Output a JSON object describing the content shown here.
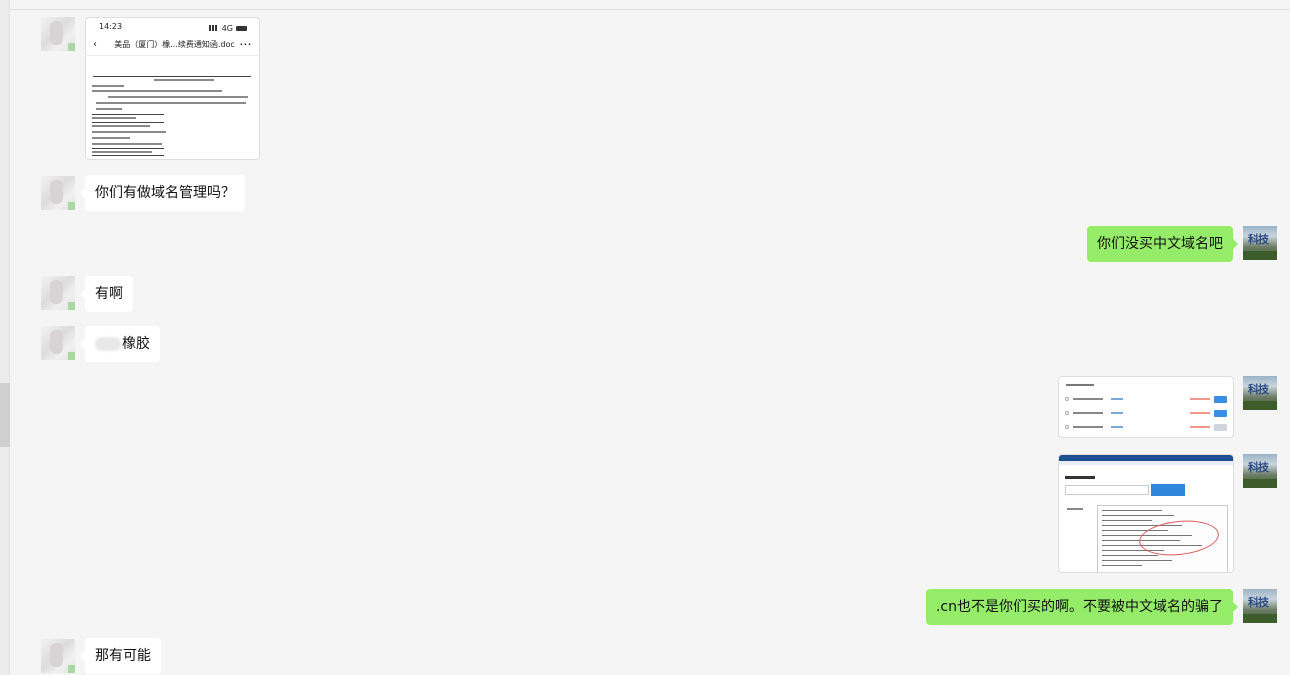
{
  "phone_doc": {
    "time": "14:23",
    "network": "4G",
    "title": "美品（厦门）橡...续费通知函.doc",
    "more": "···",
    "back": "‹"
  },
  "messages": [
    {
      "side": "left",
      "type": "image",
      "desc": "doc-screenshot"
    },
    {
      "side": "left",
      "type": "text",
      "text": "你们有做域名管理吗？"
    },
    {
      "side": "right",
      "type": "text",
      "text": "你们没买中文域名吧"
    },
    {
      "side": "left",
      "type": "text",
      "text": "有啊"
    },
    {
      "side": "left",
      "type": "text",
      "text": "橡胶"
    },
    {
      "side": "right",
      "type": "image",
      "desc": "domain-list-screenshot"
    },
    {
      "side": "right",
      "type": "image",
      "desc": "whois-screenshot"
    },
    {
      "side": "right",
      "type": "text",
      "text": ".cn也不是你们买的啊。不要被中文域名的骗了"
    },
    {
      "side": "left",
      "type": "text",
      "text": "那有可能"
    }
  ]
}
